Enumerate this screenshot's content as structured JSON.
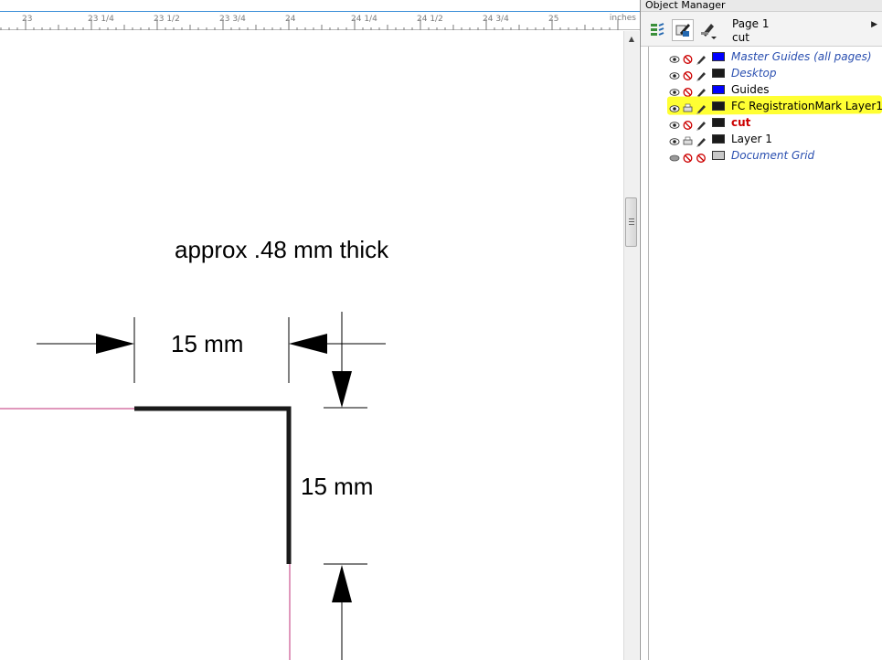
{
  "ruler": {
    "labels": [
      "23",
      "23 1/4",
      "23 1/2",
      "23 3/4",
      "24",
      "24 1/4",
      "24 1/2",
      "24 3/4",
      "25"
    ],
    "unit": "inches"
  },
  "canvas": {
    "thickness_note": "approx .48 mm thick",
    "horizontal_dimension": "15 mm",
    "vertical_dimension": "15 mm",
    "corner_mark_color": "#1a1a1a",
    "page_border_color": "#c0307a"
  },
  "object_manager": {
    "title": "Object Manager",
    "page_name": "Page 1",
    "active_layer": "cut",
    "layers": [
      {
        "name": "Master Guides (all pages)",
        "style": "guide",
        "color": "#0000ff"
      },
      {
        "name": "Desktop",
        "style": "guide",
        "color": "#1a1a1a"
      },
      {
        "name": "Guides",
        "style": "normal",
        "color": "#0000ff"
      },
      {
        "name": "FC RegistrationMark Layer1",
        "style": "normal",
        "color": "#1a1a1a",
        "highlighted": true
      },
      {
        "name": "cut",
        "style": "cut",
        "color": "#1a1a1a"
      },
      {
        "name": "Layer 1",
        "style": "normal",
        "color": "#1a1a1a"
      },
      {
        "name": "Document Grid",
        "style": "guide",
        "color": "#c8c8c8"
      }
    ]
  }
}
